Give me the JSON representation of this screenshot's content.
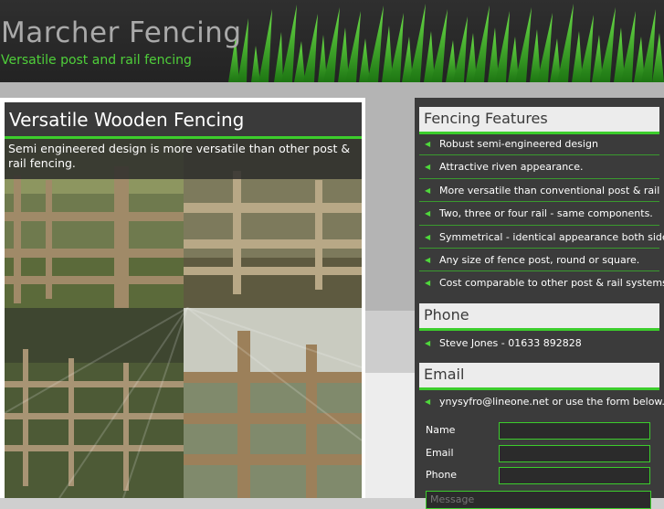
{
  "header": {
    "title": "Marcher Fencing",
    "tagline": "Versatile post and rail fencing"
  },
  "main": {
    "heading": "Versatile Wooden Fencing",
    "caption": "Semi engineered design is more versatile than other post & rail fencing."
  },
  "features": {
    "heading": "Fencing Features",
    "items": [
      "Robust semi-engineered design",
      "Attractive riven appearance.",
      "More versatile than conventional post & rail",
      "Two, three or four rail - same components.",
      "Symmetrical - identical appearance both sides.",
      "Any size of fence post, round or square.",
      "Cost comparable to other post & rail systems."
    ]
  },
  "phone": {
    "heading": "Phone",
    "text": "Steve Jones - 01633 892828"
  },
  "email": {
    "heading": "Email",
    "text": "ynysyfro@lineone.net or use the form below."
  },
  "form": {
    "name_label": "Name",
    "email_label": "Email",
    "phone_label": "Phone",
    "name_value": "",
    "email_value": "",
    "phone_value": "",
    "message_placeholder": "Message"
  },
  "colors": {
    "accent_green": "#3ccd2c",
    "dark_panel": "#3b3b3b",
    "header_bg": "#2a2a2a"
  }
}
